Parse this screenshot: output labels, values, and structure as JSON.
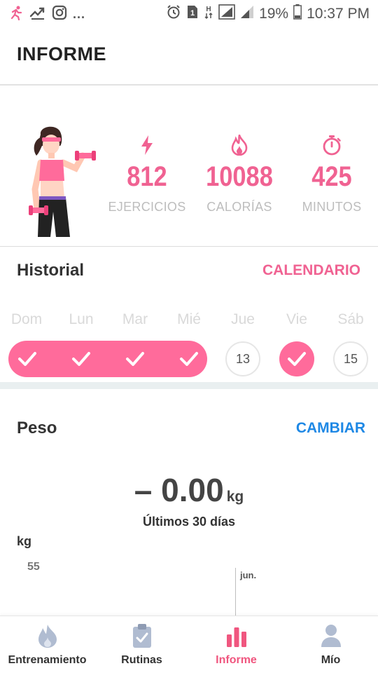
{
  "status_bar": {
    "overflow": "...",
    "battery_percent": "19%",
    "time": "10:37 PM",
    "sim_slot": "1",
    "network_letter": "H"
  },
  "header": {
    "title": "INFORME"
  },
  "summary": {
    "stats": [
      {
        "icon": "lightning-icon",
        "value": "812",
        "label": "EJERCICIOS"
      },
      {
        "icon": "flame-icon",
        "value": "10088",
        "label": "CALORÍAS"
      },
      {
        "icon": "stopwatch-icon",
        "value": "425",
        "label": "MINUTOS"
      }
    ],
    "accent_color": "#f06292"
  },
  "history": {
    "title": "Historial",
    "calendar_link": "CALENDARIO",
    "days": [
      {
        "label": "Dom",
        "done": true
      },
      {
        "label": "Lun",
        "done": true
      },
      {
        "label": "Mar",
        "done": true
      },
      {
        "label": "Mié",
        "done": true
      },
      {
        "label": "Jue",
        "done": false,
        "date": "13"
      },
      {
        "label": "Vie",
        "done": true
      },
      {
        "label": "Sáb",
        "done": false,
        "date": "15"
      }
    ],
    "done_color": "#ff6b9b"
  },
  "weight": {
    "title": "Peso",
    "change_link": "CAMBIAR",
    "value": "– 0.00",
    "unit": "kg",
    "period": "Últimos 30 días",
    "axis_unit": "kg",
    "y_tick": "55",
    "month_label": "jun.",
    "link_color": "#1e88e5"
  },
  "nav": {
    "items": [
      {
        "label": "Entrenamiento",
        "icon": "flame-icon",
        "active": false
      },
      {
        "label": "Rutinas",
        "icon": "clipboard-icon",
        "active": false
      },
      {
        "label": "Informe",
        "icon": "bar-chart-icon",
        "active": true
      },
      {
        "label": "Mío",
        "icon": "person-icon",
        "active": false
      }
    ],
    "active_color": "#f0567f"
  }
}
